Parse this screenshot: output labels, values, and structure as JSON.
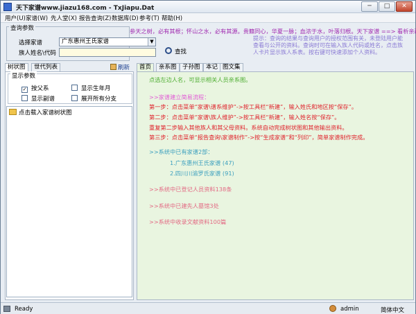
{
  "window": {
    "title": "天下家谱www.jiazu168.com - TxJiapu.Dat",
    "min_label": "─",
    "max_label": "□",
    "close_label": "✕"
  },
  "menu": [
    "用户(U)",
    "家谱(W)",
    "先人堂(X)",
    "报告查询(Z)",
    "数据库(D)",
    "参考(T)",
    "帮助(H)"
  ],
  "query": {
    "legend": "查询参数",
    "genealogy_label": "选择家谱",
    "genealogy_value": "广东惠州王氏家谱",
    "code_label": "族人姓名\\代码",
    "code_value": "",
    "search_button": "查找"
  },
  "slogan": "参天之树，必有其根；怀山之水，必有其源。贵籍同心，华夏一脉；血浓于水，叶落归根。天下家谱 ==> 看析亲疏",
  "tip": "提示：查询的结果与查询用户的授权范围有关，未登陆用户能查看与公开的资料。查询时可在输入族人代码或姓名，点击族人卡片显示族人系表。按右键可快速添加个人资料。",
  "left_tabs": [
    "树状图",
    "世代列表"
  ],
  "refresh_label": "刷新",
  "display": {
    "legend": "显示参数",
    "options": [
      {
        "label": "按父系",
        "checked": true
      },
      {
        "label": "显示生年月",
        "checked": false
      },
      {
        "label": "显示副谱",
        "checked": false
      },
      {
        "label": "展开所有分支",
        "checked": false
      }
    ]
  },
  "tree": {
    "item": "点击载入家谱树状图"
  },
  "right_tabs": [
    "首页",
    "亲系图",
    "子孙图",
    "本记",
    "图文集"
  ],
  "home": {
    "click_hint": "点选左边人名，可显示相关人员亲系图。",
    "flow_title": ">>家谱建立简易流程：",
    "steps": [
      "第一步：点击菜单“家谱\\谱系维护”->按工具栏“新建”，输入姓氏和地区按“保存”。",
      "第二步：点击菜单“家谱\\族人维护”->按工具栏“新建”，输入姓名按“保存”。",
      "重复第二步输入其他族人和其父母资料。系统自动完成树状图和其他输出资料。",
      "第三步：点击菜单“报告查询\\家谱制作”->按“生成家谱”和“列印”，简单家谱制作完成。"
    ],
    "count_title": ">>系统中已有家谱2部：",
    "genealogies": [
      "1.广东惠州王氏家谱 (47)",
      "2.四川川渝罗氏家谱 (91)"
    ],
    "people_line": ">>系统中已登记人员资料138条",
    "ancestor_line": ">>系统中已建先人墓馆3处",
    "docs_line": ">>系统中收录文献资料100篇"
  },
  "status": {
    "text": "Ready",
    "user": "admin",
    "version": "简体中文"
  }
}
